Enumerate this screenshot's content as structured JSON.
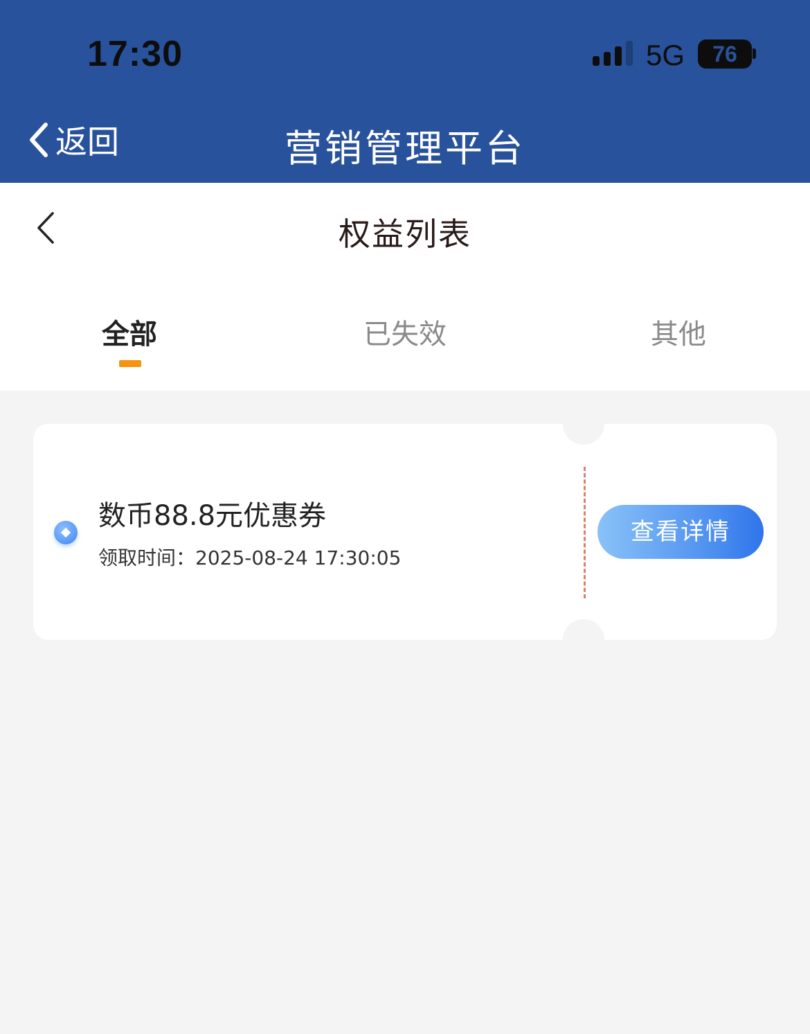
{
  "status_bar": {
    "time": "17:30",
    "network": "5G",
    "battery": "76"
  },
  "nav": {
    "back_label": "返回",
    "app_title": "营销管理平台"
  },
  "page": {
    "title": "权益列表"
  },
  "tabs": [
    {
      "label": "全部",
      "active": true
    },
    {
      "label": "已失效",
      "active": false
    },
    {
      "label": "其他",
      "active": false
    }
  ],
  "coupons": [
    {
      "name": "数币88.8元优惠券",
      "claim_time_label": "领取时间：",
      "claim_time": "2025-08-24 17:30:05",
      "action_label": "查看详情"
    }
  ],
  "colors": {
    "header_bg": "#29529c",
    "tab_indicator": "#f5940f",
    "button_gradient_start": "#89c2f8",
    "button_gradient_end": "#2f74ea",
    "divider": "#dc7f6a",
    "page_bg": "#f4f4f4"
  }
}
